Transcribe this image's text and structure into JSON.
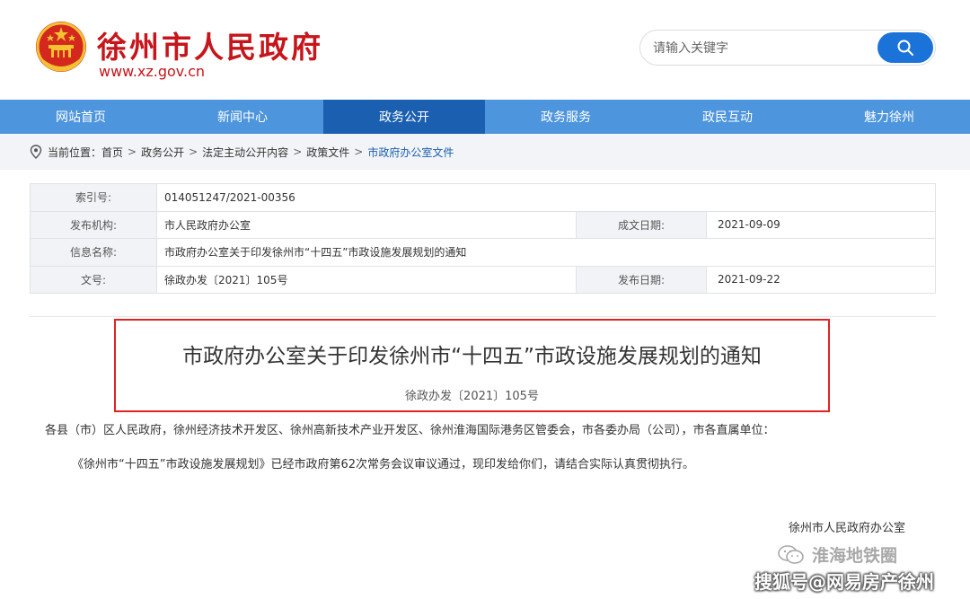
{
  "header": {
    "site_title": "徐州市人民政府",
    "site_url": "www.xz.gov.cn",
    "search_placeholder": "请输入关键字",
    "brand_red": "#c6151b",
    "search_button_color": "#1b72d8"
  },
  "nav": {
    "items": [
      {
        "label": "网站首页",
        "active": false
      },
      {
        "label": "新闻中心",
        "active": false
      },
      {
        "label": "政务公开",
        "active": true
      },
      {
        "label": "政务服务",
        "active": false
      },
      {
        "label": "政民互动",
        "active": false
      },
      {
        "label": "魅力徐州",
        "active": false
      }
    ],
    "bg_color": "#4d95dc",
    "active_color": "#1a5fb0"
  },
  "breadcrumb": {
    "prefix": "当前位置：",
    "items": [
      "首页",
      "政务公开",
      "法定主动公开内容",
      "政策文件",
      "市政府办公室文件"
    ],
    "icon": "location-pin-icon"
  },
  "info": {
    "index_label": "索引号:",
    "index_value": "014051247/2021-00356",
    "org_label": "发布机构:",
    "org_value": "市人民政府办公室",
    "written_label": "成文日期:",
    "written_value": "2021-09-09",
    "name_label": "信息名称:",
    "name_value": "市政府办公室关于印发徐州市“十四五”市政设施发展规划的通知",
    "docno_label": "文号:",
    "docno_value": "徐政办发〔2021〕105号",
    "pub_label": "发布日期:",
    "pub_value": "2021-09-22"
  },
  "document": {
    "title": "市政府办公室关于印发徐州市“十四五”市政设施发展规划的通知",
    "number": "徐政办发〔2021〕105号",
    "addressee": "各县（市）区人民政府，徐州经济技术开发区、徐州高新技术产业开发区、徐州淮海国际港务区管委会，市各委办局（公司），市各直属单位：",
    "paragraph": "《徐州市“十四五”市政设施发展规划》已经市政府第62次常务会议审议通过，现印发给你们，请结合实际认真贯彻执行。",
    "signature": "徐州市人民政府办公室",
    "highlight_color": "#e02424"
  },
  "watermarks": {
    "wechat_account": "淮海地铁圈",
    "sohu": "搜狐号@网易房产徐州"
  }
}
